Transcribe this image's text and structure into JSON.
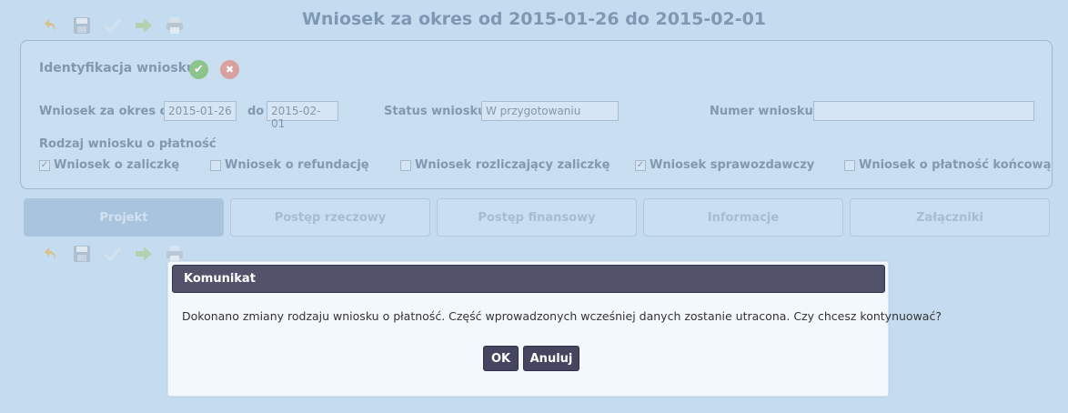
{
  "toolbar_icons": [
    "undo-icon",
    "save-icon",
    "check-icon",
    "forward-arrow-icon",
    "print-icon"
  ],
  "page_title": "Wniosek za okres od 2015-01-26 do 2015-02-01",
  "identification": {
    "title": "Identyfikacja wniosku",
    "period_label": "Wniosek za okres od",
    "period_from": "2015-01-26",
    "period_to_label": "do",
    "period_to": "2015-02-01",
    "status_label": "Status wniosku",
    "status_value": "W przygotowaniu",
    "number_label": "Numer wniosku",
    "number_value": "",
    "payment_type_label": "Rodzaj wniosku o płatność",
    "payment_types": [
      {
        "label": "Wniosek o zaliczkę",
        "checked": true
      },
      {
        "label": "Wniosek o refundację",
        "checked": false
      },
      {
        "label": "Wniosek rozliczający zaliczkę",
        "checked": false
      },
      {
        "label": "Wniosek sprawozdawczy",
        "checked": true
      },
      {
        "label": "Wniosek o płatność końcową",
        "checked": false
      }
    ]
  },
  "tabs": [
    {
      "label": "Projekt",
      "active": true
    },
    {
      "label": "Postęp rzeczowy",
      "active": false
    },
    {
      "label": "Postęp finansowy",
      "active": false
    },
    {
      "label": "Informacje",
      "active": false
    },
    {
      "label": "Załączniki",
      "active": false
    }
  ],
  "dialog": {
    "title": "Komunikat",
    "message": "Dokonano zmiany rodzaju wniosku o płatność. Część wprowadzonych wcześniej danych zostanie utracona. Czy chcesz kontynuować?",
    "ok_label": "OK",
    "cancel_label": "Anuluj"
  },
  "colors": {
    "background": "#c5dcf0",
    "dialog_header": "#52526a",
    "button": "#45455f",
    "check_ok": "#8cc48c",
    "check_err": "#d9a0a0"
  }
}
